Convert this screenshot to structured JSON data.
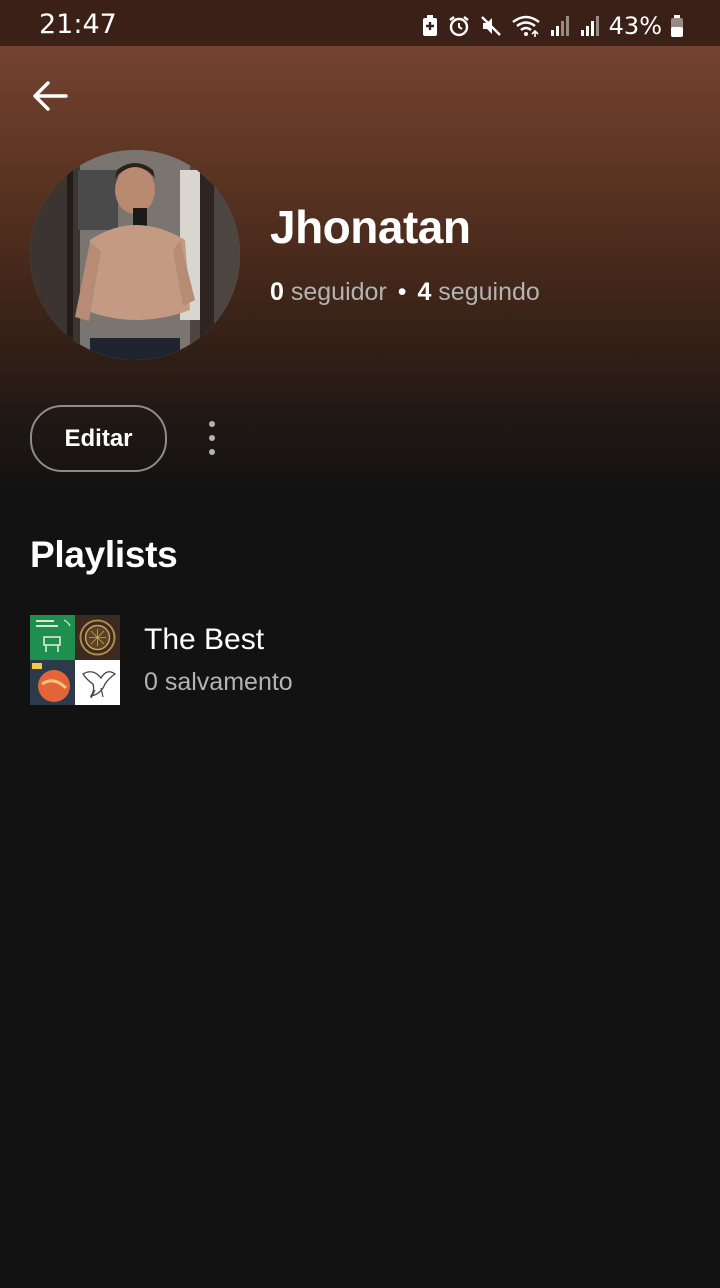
{
  "status_bar": {
    "time": "21:47",
    "battery_percent": "43%",
    "icons": [
      "battery-saver-icon",
      "alarm-icon",
      "mute-icon",
      "wifi-icon",
      "signal-icon",
      "signal-icon",
      "battery-icon"
    ]
  },
  "header": {
    "back_icon": "arrow-left-icon",
    "accent_color": "#744330"
  },
  "profile": {
    "name": "Jhonatan",
    "followers_count": "0",
    "followers_label": "seguidor",
    "separator": "•",
    "following_count": "4",
    "following_label": "seguindo"
  },
  "actions": {
    "edit_label": "Editar",
    "more_icon": "more-vertical-icon"
  },
  "playlists": {
    "section_title": "Playlists",
    "items": [
      {
        "name": "The Best",
        "meta": "0 salvamento"
      }
    ]
  }
}
